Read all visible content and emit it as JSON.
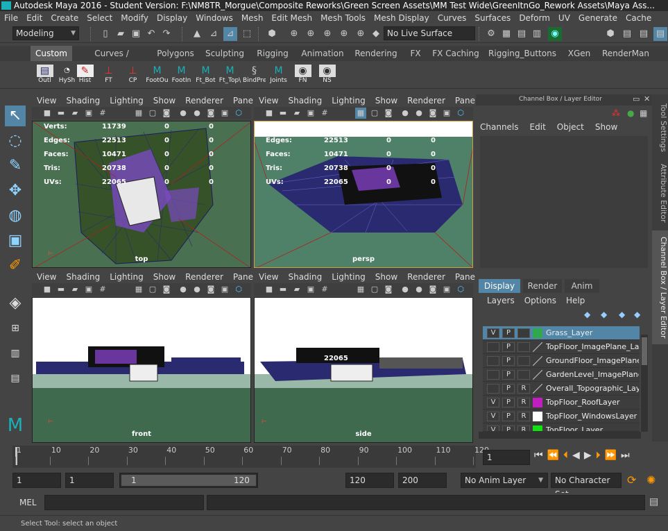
{
  "title": "Autodesk Maya 2016 - Student Version: F:\\NM8TR_Morgue\\Composite Reworks\\Green Screen Assets\\MM Test Wide\\GreenItnGo_Rework Assets\\Maya Ass...",
  "menus": [
    "File",
    "Edit",
    "Create",
    "Select",
    "Modify",
    "Display",
    "Windows",
    "Mesh",
    "Edit Mesh",
    "Mesh Tools",
    "Mesh Display",
    "Curves",
    "Surfaces",
    "Deform",
    "UV",
    "Generate",
    "Cache"
  ],
  "status": {
    "mode": "Modeling",
    "live_surface": "No Live Surface"
  },
  "shelf_tabs": [
    "Custom",
    "Curves / Surfaces",
    "Polygons",
    "Sculpting",
    "Rigging",
    "Animation",
    "Rendering",
    "FX",
    "FX Caching",
    "Rigging_Buttons",
    "XGen",
    "RenderMan"
  ],
  "shelf_icons": [
    {
      "label": "Outl",
      "icon": "outliner-icon"
    },
    {
      "label": "HySh",
      "icon": "hypershade-icon"
    },
    {
      "label": "Hist",
      "icon": "history-icon"
    },
    {
      "label": "FT",
      "icon": "freeze-transform-icon"
    },
    {
      "label": "CP",
      "icon": "center-pivot-icon"
    },
    {
      "label": "FootOu",
      "icon": "maya-icon"
    },
    {
      "label": "FootIn",
      "icon": "maya-icon"
    },
    {
      "label": "Ft_Bot",
      "icon": "maya-icon"
    },
    {
      "label": "Ft_Top\\",
      "icon": "maya-icon"
    },
    {
      "label": "BindPre",
      "icon": "python-icon"
    },
    {
      "label": "Joints",
      "icon": "maya-icon"
    },
    {
      "label": "FN",
      "icon": "eye-icon"
    },
    {
      "label": "NS",
      "icon": "eye-icon"
    }
  ],
  "panel_menu": [
    "View",
    "Shading",
    "Lighting",
    "Show",
    "Renderer",
    "Panels"
  ],
  "hud": {
    "labels": [
      "Verts:",
      "Edges:",
      "Faces:",
      "Tris:",
      "UVs:"
    ],
    "values": [
      "11739",
      "22513",
      "10471",
      "20738",
      "22065"
    ],
    "zero": "0"
  },
  "cameras": {
    "top": "top",
    "persp": "persp",
    "front": "front",
    "side": "side"
  },
  "channel_box": {
    "title": "Channel Box / Layer Editor",
    "menus": [
      "Channels",
      "Edit",
      "Object",
      "Show"
    ]
  },
  "layer_tabs": [
    "Display",
    "Render",
    "Anim"
  ],
  "layer_menus": [
    "Layers",
    "Options",
    "Help"
  ],
  "layers": [
    {
      "v": "V",
      "p": "P",
      "r": "",
      "name": "Grass_Layer",
      "color": "#2fa84f",
      "selected": true
    },
    {
      "v": "",
      "p": "P",
      "r": "",
      "name": "TopFloor_ImagePlane_Layer",
      "color": "",
      "selected": false
    },
    {
      "v": "",
      "p": "P",
      "r": "",
      "name": "GroundFloor_ImagePlane_Layer",
      "color": "",
      "selected": false
    },
    {
      "v": "",
      "p": "P",
      "r": "",
      "name": "GardenLevel_ImagePlane_Layer",
      "color": "",
      "selected": false
    },
    {
      "v": "",
      "p": "P",
      "r": "R",
      "name": "Overall_Topographic_Layer",
      "color": "",
      "selected": false
    },
    {
      "v": "V",
      "p": "P",
      "r": "R",
      "name": "TopFloor_RoofLayer",
      "color": "#c01ec0",
      "selected": false
    },
    {
      "v": "V",
      "p": "P",
      "r": "R",
      "name": "TopFloor_WindowsLayer",
      "color": "#ffffff",
      "selected": false
    },
    {
      "v": "V",
      "p": "P",
      "r": "R",
      "name": "TopFloor_Layer",
      "color": "#11e011",
      "selected": false
    }
  ],
  "side_tabs": [
    "Tool Settings",
    "Attribute Editor",
    "Channel Box / Layer Editor"
  ],
  "timeline": {
    "ticks": [
      "1",
      "10",
      "20",
      "30",
      "40",
      "50",
      "60",
      "70",
      "80",
      "90",
      "100",
      "110",
      "120"
    ],
    "current": "1"
  },
  "range": {
    "start": "1",
    "playback_start": "1",
    "slider_start": "1",
    "slider_end": "120",
    "playback_end": "120",
    "end": "200",
    "anim_layer": "No Anim Layer",
    "character_set": "No Character Set"
  },
  "mel": {
    "label": "MEL"
  },
  "help": "Select Tool: select an object"
}
